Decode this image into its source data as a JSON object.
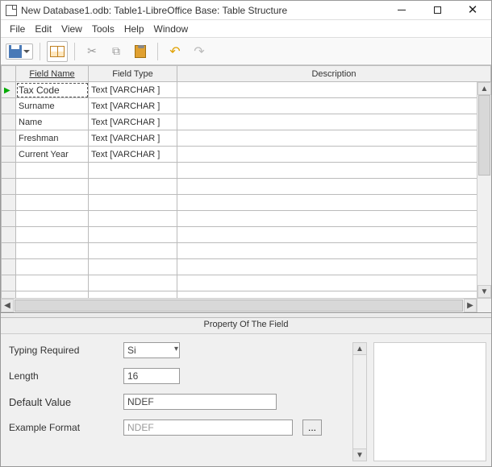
{
  "window": {
    "title": "New Database1.odb: Table1-LibreOffice Base: Table Structure"
  },
  "menu": {
    "file": "File",
    "edit": "Edit",
    "view": "View",
    "tools": "Tools",
    "help": "Help",
    "window": "Window"
  },
  "toolbar": {
    "save": "save",
    "table": "table-design",
    "cut": "cut",
    "copy": "copy",
    "paste": "paste",
    "undo": "undo",
    "redo": "redo"
  },
  "grid": {
    "headers": {
      "field_name": "Field Name",
      "field_type": "Field Type",
      "description": "Description"
    },
    "rows": [
      {
        "name": "Tax Code",
        "type": "Text [VARCHAR ]",
        "desc": ""
      },
      {
        "name": "Surname",
        "type": "Text [VARCHAR ]",
        "desc": ""
      },
      {
        "name": "Name",
        "type": "Text [VARCHAR ]",
        "desc": ""
      },
      {
        "name": "Freshman",
        "type": "Text [VARCHAR ]",
        "desc": ""
      },
      {
        "name": "Current Year",
        "type": "Text [VARCHAR ]",
        "desc": ""
      }
    ]
  },
  "prop": {
    "title": "Property Of The Field",
    "labels": {
      "typing_required": "Typing Required",
      "length": "Length",
      "default_value": "Default Value",
      "example_format": "Example Format"
    },
    "values": {
      "typing_required": "Si",
      "length": "16",
      "default_value": "NDEF",
      "example_format": "NDEF"
    },
    "browse": "..."
  }
}
